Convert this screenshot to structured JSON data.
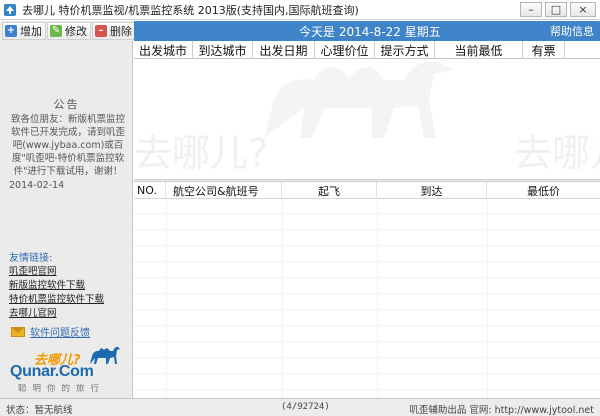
{
  "titlebar": {
    "title": "去哪儿 特价机票监视/机票监控系统 2013版(支持国内,国际航班查询)",
    "minimize": "–",
    "maximize": "□",
    "close": "×"
  },
  "toolbar": {
    "add_label": "增加",
    "edit_label": "修改",
    "delete_label": "删除"
  },
  "header": {
    "today": "今天是 2014-8-22 星期五",
    "help": "帮助信息"
  },
  "monitor_table": {
    "columns": [
      "出发城市",
      "到达城市",
      "出发日期",
      "心理价位",
      "提示方式",
      "当前最低",
      "有票"
    ],
    "watermark": "去哪儿?"
  },
  "result_table": {
    "columns": [
      "NO.",
      "航空公司&航班号",
      "起飞",
      "到达",
      "最低价"
    ]
  },
  "sidebar": {
    "notice_title": "公告",
    "notice_body": "致各位朋友：新版机票监控软件已开发完成，请到叽歪吧(www.jybaa.com)或百度\"叽歪吧-特价机票监控软件\"进行下载试用，谢谢！",
    "notice_date": "2014-02-14",
    "friend_links_title": "友情链接:",
    "links": [
      "叽歪吧官网",
      "新版监控软件下载",
      "特价机票监控软件下载",
      "去哪儿官网"
    ],
    "feedback": "软件问题反馈",
    "logo": {
      "cn": "去哪儿?",
      "en": "Qunar.Com",
      "slogan": "聪明你的旅行"
    }
  },
  "statusbar": {
    "status": "状态：暂无航线",
    "count": "(4/92724)",
    "credit": "叽歪辅助出品 官网: http://www.jytool.net"
  }
}
